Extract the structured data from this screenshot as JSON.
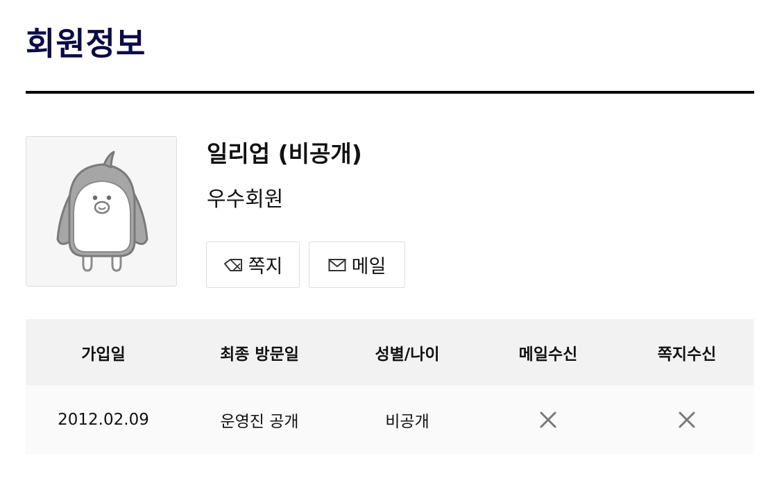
{
  "page": {
    "title": "회원정보"
  },
  "profile": {
    "avatar_icon": "penguin-avatar-icon",
    "name": "일리업 (비공개)",
    "level": "우수회원",
    "buttons": {
      "memo_label": "쪽지",
      "memo_icon": "memo-icon",
      "mail_label": "메일",
      "mail_icon": "mail-icon"
    }
  },
  "info_table": {
    "headers": [
      "가입일",
      "최종 방문일",
      "성별/나이",
      "메일수신",
      "쪽지수신"
    ],
    "row": {
      "join_date": "2012.02.09",
      "last_visit": "운영진 공개",
      "gender_age": "비공개",
      "mail_receive_icon": "x-icon",
      "memo_receive_icon": "x-icon"
    }
  },
  "colors": {
    "title": "#0b0b45",
    "rule": "#000000",
    "table_header_bg": "#f2f2f2",
    "table_row_bg": "#fafafa",
    "x_mark": "#777777"
  }
}
